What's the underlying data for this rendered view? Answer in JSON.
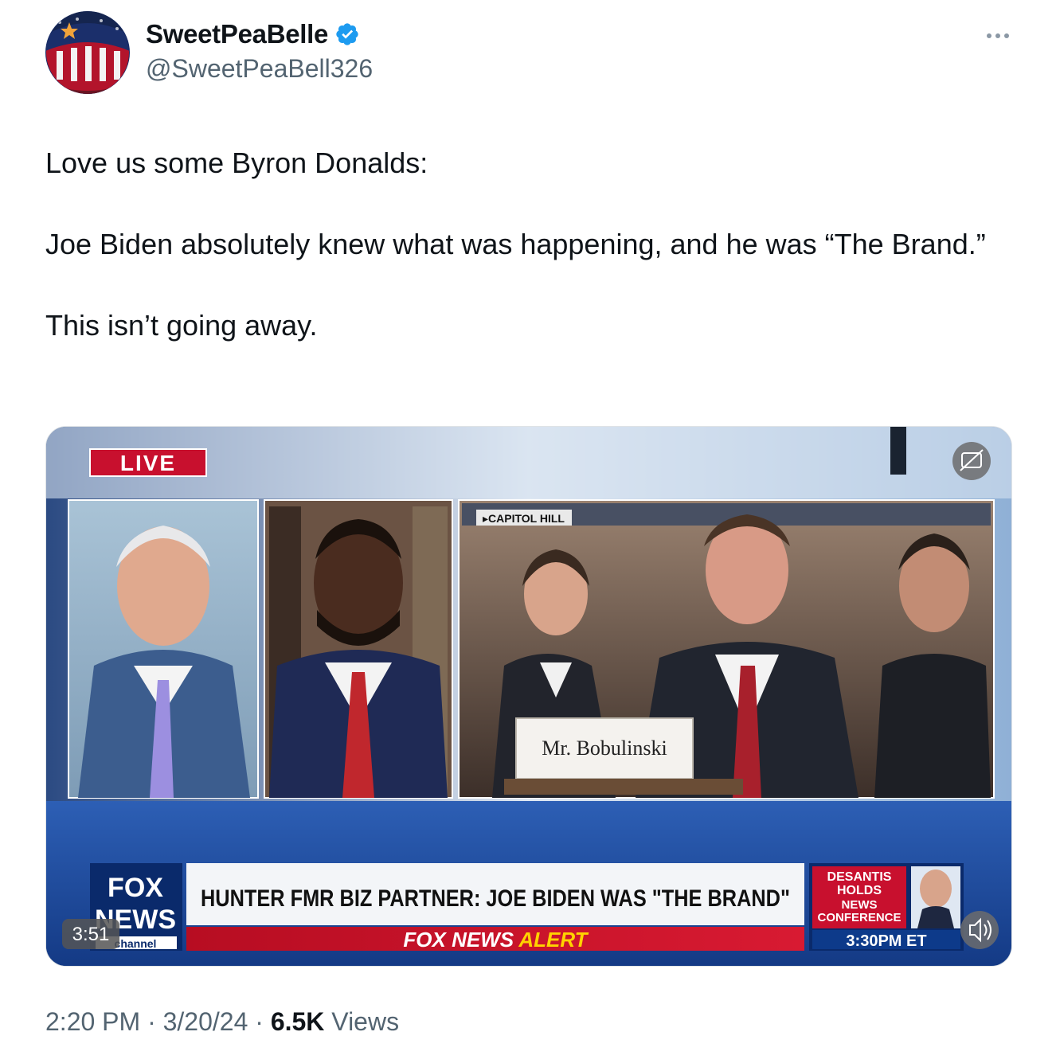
{
  "author": {
    "display_name": "SweetPeaBelle",
    "handle": "@SweetPeaBell326",
    "avatar_icon": "patriotic-lips-avatar",
    "verified_color": "#1d9bf0"
  },
  "tweet": {
    "paragraphs": [
      "Love us some Byron Donalds:",
      "Joe Biden absolutely knew what was happening, and he was  “The Brand.”",
      "This isn’t going away."
    ]
  },
  "video": {
    "live_badge": "LIVE",
    "location_tag": "CAPITOL HILL",
    "name_placard": "Mr. Bobulinski",
    "network_logo": [
      "FOX",
      "NEWS",
      "channel"
    ],
    "headline": "HUNTER FMR BIZ PARTNER: JOE BIDEN WAS \"THE BRAND\"",
    "alert_prefix": "FOX NEWS",
    "alert_word": "ALERT",
    "promo": {
      "line1": "DESANTIS",
      "line2": "HOLDS",
      "line3": "NEWS",
      "line4": "CONFERENCE",
      "time": "3:30PM ET"
    },
    "duration": "3:51",
    "colors": {
      "fox_red": "#c8102e",
      "fox_blue": "#0a2a6b",
      "alert_yellow": "#ffd200"
    }
  },
  "meta": {
    "time": "2:20 PM",
    "date": "3/20/24",
    "separator": "·",
    "views_count": "6.5K",
    "views_label": "Views"
  }
}
